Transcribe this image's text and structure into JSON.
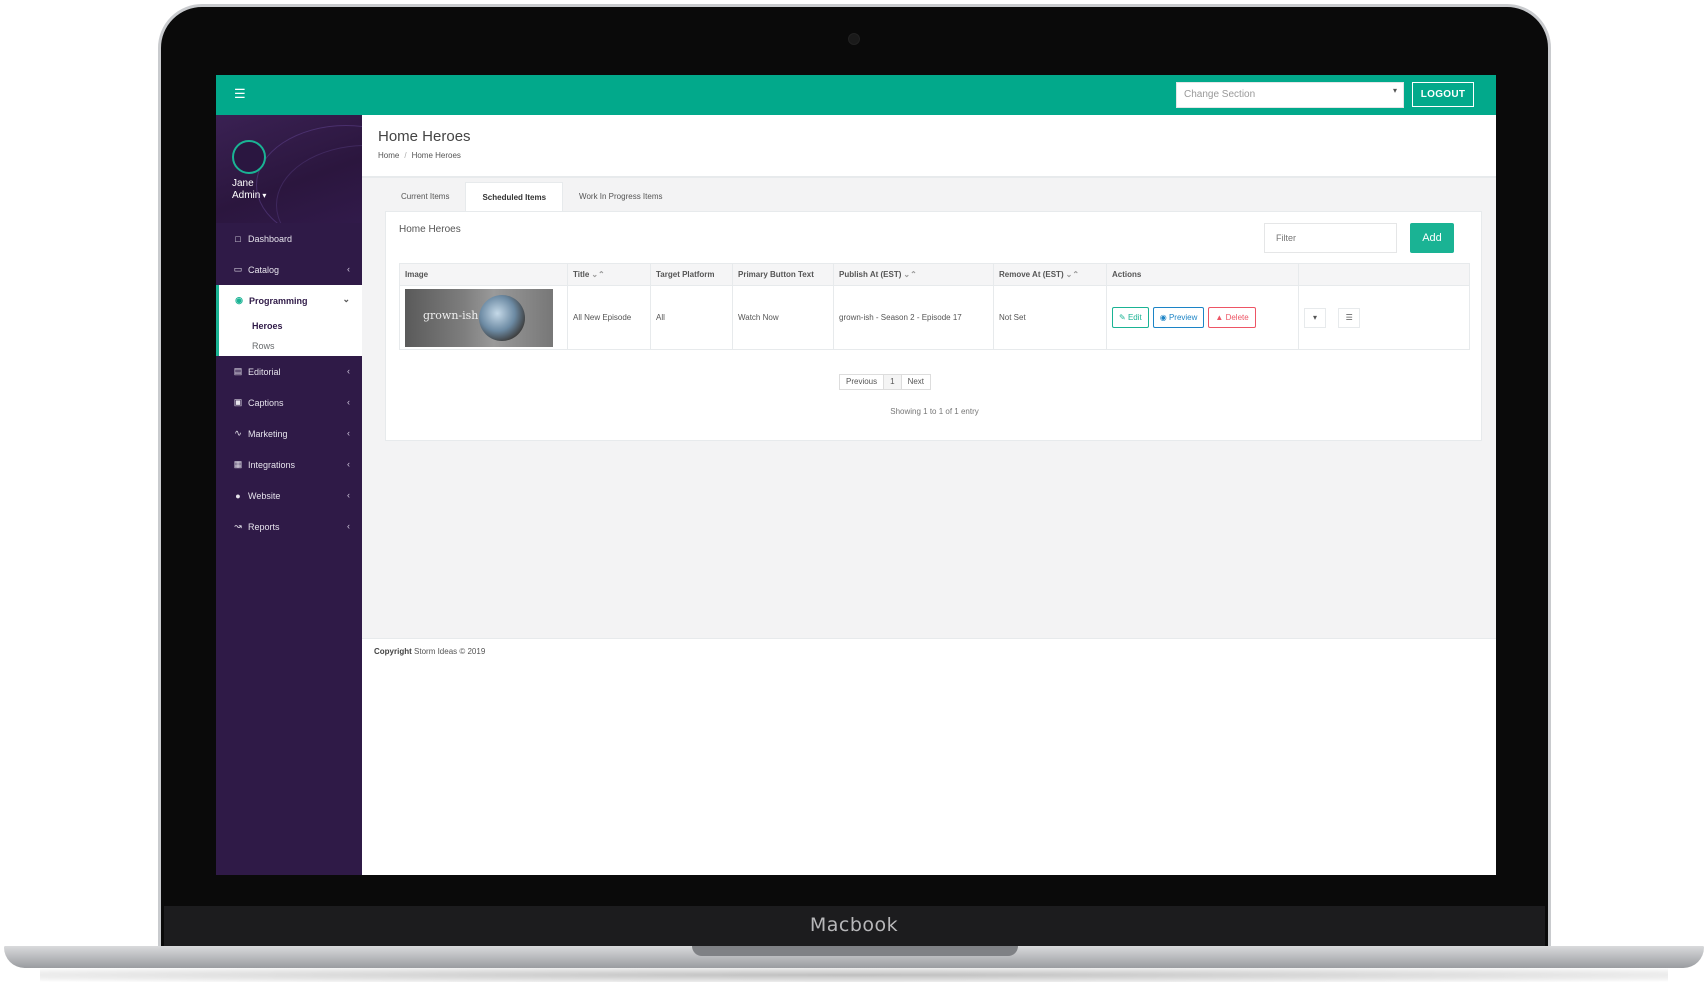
{
  "device": {
    "brand": "Macbook"
  },
  "topbar": {
    "change_section_placeholder": "Change Section",
    "logout_label": "LOGOUT"
  },
  "profile": {
    "name": "Jane",
    "role": "Admin"
  },
  "sidebar": {
    "items": [
      {
        "label": "Dashboard",
        "icon": "laptop-icon"
      },
      {
        "label": "Catalog",
        "icon": "monitor-icon"
      },
      {
        "label": "Programming",
        "icon": "dot-circle-icon",
        "expanded": true,
        "children": [
          {
            "label": "Heroes",
            "active": true
          },
          {
            "label": "Rows"
          }
        ]
      },
      {
        "label": "Editorial",
        "icon": "newspaper-icon"
      },
      {
        "label": "Captions",
        "icon": "cc-icon"
      },
      {
        "label": "Marketing",
        "icon": "rss-icon"
      },
      {
        "label": "Integrations",
        "icon": "calendar-icon"
      },
      {
        "label": "Website",
        "icon": "globe-icon"
      },
      {
        "label": "Reports",
        "icon": "line-chart-icon"
      }
    ]
  },
  "header": {
    "title": "Home Heroes",
    "breadcrumb": [
      "Home",
      "Home Heroes"
    ]
  },
  "tabs": [
    "Current Items",
    "Scheduled Items",
    "Work In Progress Items"
  ],
  "panel": {
    "title": "Home Heroes",
    "filter_placeholder": "Filter",
    "add_label": "Add"
  },
  "table": {
    "columns": [
      "Image",
      "Title",
      "Target Platform",
      "Primary Button Text",
      "Publish At (EST)",
      "Remove At (EST)",
      "Actions"
    ],
    "rows": [
      {
        "image_text": "grown-ish",
        "title": "All New Episode",
        "target_platform": "All",
        "primary_button_text": "Watch Now",
        "publish_at": "grown-ish - Season 2 - Episode 17",
        "remove_at": "Not Set",
        "actions": {
          "edit": "Edit",
          "preview": "Preview",
          "delete": "Delete"
        }
      }
    ]
  },
  "pagination": {
    "previous": "Previous",
    "page": "1",
    "next": "Next",
    "showing": "Showing 1 to 1 of 1 entry"
  },
  "footer": {
    "copyright_label": "Copyright",
    "copyright_text": "Storm Ideas © 2019"
  },
  "colors": {
    "accent": "#02a98b",
    "sidebar": "#2f1a47",
    "edit": "#1ab394",
    "preview": "#1c84c6",
    "delete": "#ed5565"
  }
}
